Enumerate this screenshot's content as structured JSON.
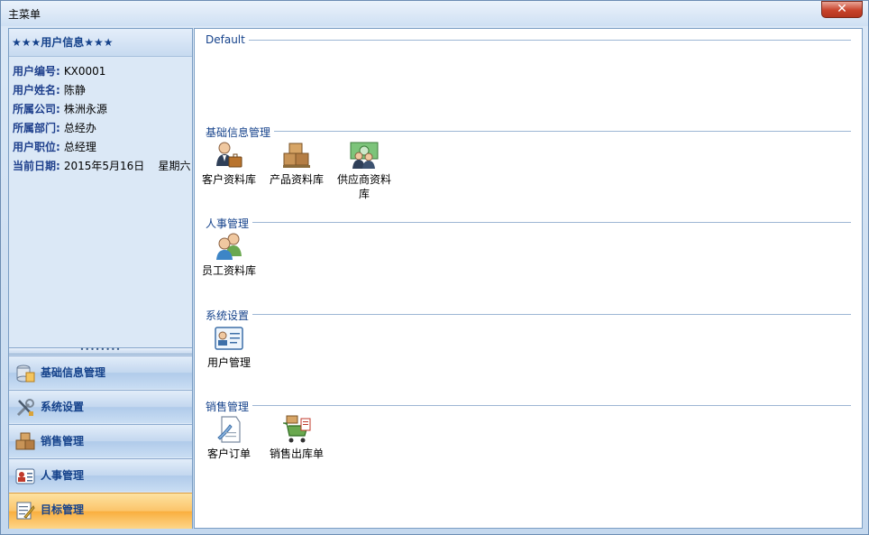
{
  "window": {
    "title": "主菜单",
    "close_label": "✕"
  },
  "user_info": {
    "header": "★★★用户信息★★★",
    "rows": [
      {
        "key": "用户编号:",
        "value": "KX0001"
      },
      {
        "key": "用户姓名:",
        "value": "陈静"
      },
      {
        "key": "所属公司:",
        "value": "株洲永源"
      },
      {
        "key": "所属部门:",
        "value": "总经办"
      },
      {
        "key": "用户职位:",
        "value": "总经理"
      },
      {
        "key": "当前日期:",
        "value": "2015年5月16日    星期六"
      }
    ]
  },
  "splitter": "••••••••",
  "nav": [
    {
      "label": "基础信息管理",
      "icon": "database-icon"
    },
    {
      "label": "系统设置",
      "icon": "tools-icon"
    },
    {
      "label": "销售管理",
      "icon": "boxes-icon"
    },
    {
      "label": "人事管理",
      "icon": "id-card-icon"
    },
    {
      "label": "目标管理",
      "icon": "notepad-icon",
      "active": true
    }
  ],
  "groups": [
    {
      "title": "Default",
      "tiles": []
    },
    {
      "title": "基础信息管理",
      "tiles": [
        {
          "label": "客户资料库",
          "icon": "customer-icon"
        },
        {
          "label": "产品资料库",
          "icon": "product-boxes-icon"
        },
        {
          "label": "供应商资料库",
          "icon": "supplier-icon"
        }
      ]
    },
    {
      "title": "人事管理",
      "tiles": [
        {
          "label": "员工资料库",
          "icon": "employees-icon"
        }
      ]
    },
    {
      "title": "系统设置",
      "tiles": [
        {
          "label": "用户管理",
          "icon": "user-card-icon"
        }
      ]
    },
    {
      "title": "销售管理",
      "tiles": [
        {
          "label": "客户订单",
          "icon": "order-document-icon"
        },
        {
          "label": "销售出库单",
          "icon": "shipping-cart-icon"
        }
      ]
    }
  ],
  "colors": {
    "accent": "#15428b",
    "active_nav": "#fbc46a",
    "border": "#7b9ec4"
  }
}
